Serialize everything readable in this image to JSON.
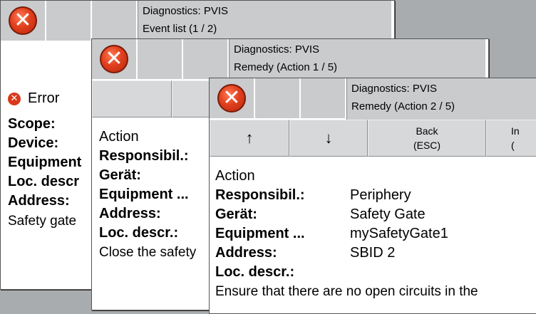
{
  "window1": {
    "title_line1": "Diagnostics: PVIS",
    "title_line2": "Event list (1 / 2)",
    "error_label": "Error",
    "fields": [
      "Scope:",
      "Device:",
      "Equipment",
      "Loc. descr",
      "Address:"
    ],
    "description": "Safety gate"
  },
  "window2": {
    "title_line1": "Diagnostics: PVIS",
    "title_line2": "Remedy (Action 1 / 5)",
    "heading": "Action",
    "fields": [
      "Responsibil.:",
      "Gerät:",
      "Equipment ...",
      "Address:",
      "Loc. descr.:"
    ],
    "description": "Close the safety"
  },
  "window3": {
    "title_line1": "Diagnostics: PVIS",
    "title_line2": "Remedy (Action 2 / 5)",
    "buttons": {
      "up": "↑",
      "down": "↓",
      "back_line1": "Back",
      "back_line2": "(ESC)",
      "info_line1": "In",
      "info_line2": "("
    },
    "heading": "Action",
    "rows": [
      {
        "label": "Responsibil.:",
        "value": "Periphery"
      },
      {
        "label": "Gerät:",
        "value": "Safety Gate"
      },
      {
        "label": "Equipment ...",
        "value": "mySafetyGate1"
      },
      {
        "label": "Address:",
        "value": "SBID 2"
      },
      {
        "label": "Loc. descr.:",
        "value": ""
      }
    ],
    "description": "Ensure that there are no open circuits in the"
  },
  "colors": {
    "background": "#a9acae",
    "header_cell": "#c9cbcd",
    "error_red": "#d9381a"
  },
  "icons": [
    "error-icon"
  ]
}
